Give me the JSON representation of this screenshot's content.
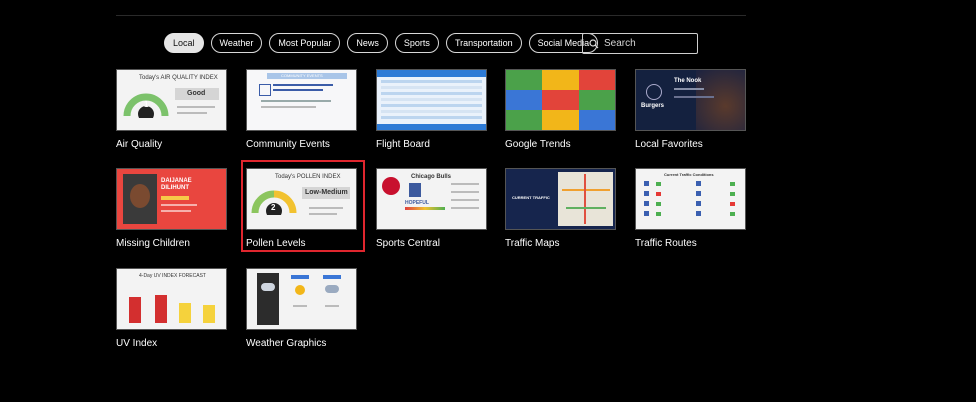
{
  "filters": [
    {
      "label": "Local",
      "active": true
    },
    {
      "label": "Weather",
      "active": false
    },
    {
      "label": "Most Popular",
      "active": false
    },
    {
      "label": "News",
      "active": false
    },
    {
      "label": "Sports",
      "active": false
    },
    {
      "label": "Transportation",
      "active": false
    },
    {
      "label": "Social Media",
      "active": false
    }
  ],
  "search": {
    "placeholder": "Search"
  },
  "tiles": [
    {
      "label": "Air Quality",
      "value": "1",
      "status": "Good",
      "heading": "Today's AIR QUALITY INDEX"
    },
    {
      "label": "Community Events",
      "heading": "COMMUNITY EVENTS"
    },
    {
      "label": "Flight Board"
    },
    {
      "label": "Google Trends"
    },
    {
      "label": "Local Favorites",
      "heading": "The Nook",
      "sub": "Burgers"
    },
    {
      "label": "Missing Children",
      "name": "DAIJANAE DILIHUNT"
    },
    {
      "label": "Pollen Levels",
      "value": "2",
      "status": "Low-Medium",
      "heading": "Today's POLLEN INDEX"
    },
    {
      "label": "Sports Central",
      "heading": "Chicago Bulls",
      "sub": "HOPEFUL"
    },
    {
      "label": "Traffic Maps",
      "heading": "CURRENT TRAFFIC"
    },
    {
      "label": "Traffic Routes",
      "heading": "Current Traffic Conditions"
    },
    {
      "label": "UV Index",
      "heading": "4-Day UV INDEX FORECAST"
    },
    {
      "label": "Weather Graphics"
    }
  ],
  "selected_tile": "Pollen Levels",
  "colors": {
    "accent_selected": "#e0262e",
    "chip_active_bg": "#e6e6e6"
  }
}
